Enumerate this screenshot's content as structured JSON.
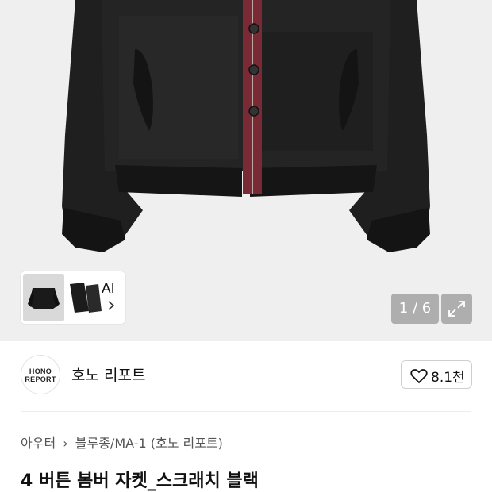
{
  "gallery": {
    "thumbnail_ai_label": "AI",
    "counter": "1 / 6"
  },
  "brand": {
    "logo_line1": "HONO",
    "logo_line2": "REPORT",
    "name": "호노 리포트",
    "like_count": "8.1천"
  },
  "breadcrumb": {
    "category": "아우터",
    "subcategory": "블루종/MA-1 (호노 리포트)"
  },
  "product": {
    "title": "4 버튼 봄버 자켓_스크래치 블랙"
  },
  "colors": {
    "jacket": "#1e1e1e",
    "placket": "#7a2a35",
    "background": "#efefef"
  }
}
